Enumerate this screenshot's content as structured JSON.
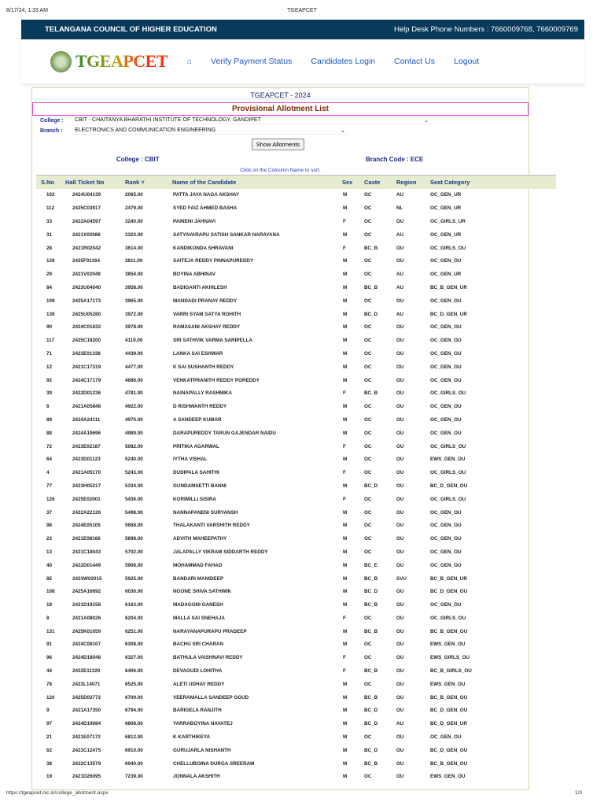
{
  "print": {
    "datetime": "8/17/24, 1:33 AM",
    "title": "TGEAPCET",
    "url": "https://tgeapcet.nic.in/college_allotment.aspx",
    "page": "1/3"
  },
  "topbar": {
    "org": "TELANGANA COUNCIL OF HIGHER EDUCATION",
    "helpdesk": "Help Desk Phone Numbers : 7660009768, 7660009769"
  },
  "nav": {
    "brand": "TGEAPCET",
    "home_icon": "home-icon",
    "home": "⌂",
    "links": [
      "Verify Payment Status",
      "Candidates Login",
      "Contact Us",
      "Logout"
    ]
  },
  "panel": {
    "year": "TGEAPCET - 2024",
    "heading": "Provisional Allotment List",
    "college_label": "College :",
    "college_value": "CBIT - CHAITANYA BHARATHI INSTITUTE OF TECHNOLOGY, GANDIPET",
    "branch_label": "Branch :",
    "branch_value": "ELECTRONICS AND COMMUNICATION ENGINEERING",
    "show_button": "Show Allotments",
    "college_info": "College : CBIT",
    "branch_info": "Branch Code : ECE",
    "hint": "Click on the Coloumn Name to sort."
  },
  "table": {
    "headers": [
      "S.No",
      "Hall Ticket No",
      "Rank ˅",
      "Name of the Candidate",
      "Sex",
      "Caste",
      "Region",
      "Seat Category"
    ],
    "rows": [
      [
        "102",
        "2424U04139",
        "2065.00",
        "PATTA JAYA NAGA AKSHAY",
        "M",
        "OC",
        "AU",
        "OC_GEN_UR"
      ],
      [
        "112",
        "2425C03917",
        "2479.00",
        "SYED FAIZ AHMED BASHA",
        "M",
        "OC",
        "NL",
        "OC_GEN_UR"
      ],
      [
        "33",
        "2422A04597",
        "3240.00",
        "PAINENI JAHNAVI",
        "F",
        "OC",
        "OU",
        "OC_GIRLS_UR"
      ],
      [
        "31",
        "2421X02086",
        "3323.00",
        "SATYAVARAPU SATISH SANKAR NARAYANA",
        "M",
        "OC",
        "AU",
        "OC_GEN_UR"
      ],
      [
        "28",
        "2421R02042",
        "3614.00",
        "KANDIKONDA SHRAVANI",
        "F",
        "BC_B",
        "OU",
        "OC_GIRLS_OU"
      ],
      [
        "128",
        "2425F01164",
        "3811.00",
        "SAITEJA REDDY PINNAPUREDDY",
        "M",
        "OC",
        "OU",
        "OC_GEN_OU"
      ],
      [
        "29",
        "2421V02049",
        "3854.00",
        "BOYINA ABHINAV",
        "M",
        "OC",
        "AU",
        "OC_GEN_UR"
      ],
      [
        "84",
        "2423U04040",
        "3958.00",
        "BADIGANTI AKHILESH",
        "M",
        "BC_B",
        "AU",
        "BC_B_GEN_UR"
      ],
      [
        "109",
        "2425A17173",
        "3965.00",
        "MANDADI PRANAY REDDY",
        "M",
        "OC",
        "OU",
        "OC_GEN_OU"
      ],
      [
        "139",
        "2425U05280",
        "3972.00",
        "VARRI SYAM SATYA ROHITH",
        "M",
        "BC_D",
        "AU",
        "BC_D_GEN_UR"
      ],
      [
        "90",
        "2424C01632",
        "3978.00",
        "RAMASANI AKSHAY REDDY",
        "M",
        "OC",
        "OU",
        "OC_GEN_OU"
      ],
      [
        "117",
        "2425C18200",
        "4119.00",
        "SRI SATHVIK VARMA SARIPELLA",
        "M",
        "OC",
        "OU",
        "OC_GEN_OU"
      ],
      [
        "71",
        "2423E01338",
        "4439.00",
        "LANKA SAI ESHWAR",
        "M",
        "OC",
        "OU",
        "OC_GEN_OU"
      ],
      [
        "12",
        "2421C17319",
        "4477.00",
        "K SAI SUSHANTH REDDY",
        "M",
        "OC",
        "OU",
        "OC_GEN_OU"
      ],
      [
        "92",
        "2424C17179",
        "4686.00",
        "VENKATPRANITH REDDY POREDDY",
        "M",
        "OC",
        "OU",
        "OC_GEN_OU"
      ],
      [
        "39",
        "2422D01236",
        "4781.00",
        "NAINAPALLY RASHMIKA",
        "F",
        "BC_B",
        "OU",
        "OC_GIRLS_OU"
      ],
      [
        "6",
        "2421A05848",
        "4922.00",
        "D RISHWANTH REDDY",
        "M",
        "OC",
        "OU",
        "OC_GEN_OU"
      ],
      [
        "89",
        "2424A24111",
        "4970.00",
        "A SANDEEP KUMAR",
        "M",
        "OC",
        "OU",
        "OC_GEN_OU"
      ],
      [
        "88",
        "2424A19696",
        "4989.00",
        "DARAPUREDDY TARUN GAJENDAR NAIDU",
        "M",
        "OC",
        "OU",
        "OC_GEN_OU"
      ],
      [
        "72",
        "2423E02187",
        "5082.00",
        "PRITIKA AGARWAL",
        "F",
        "OC",
        "OU",
        "OC_GIRLS_OU"
      ],
      [
        "64",
        "2423D01123",
        "5240.00",
        "IYTHA VISHAL",
        "M",
        "OC",
        "OU",
        "EWS_GEN_OU"
      ],
      [
        "4",
        "2421A05170",
        "5243.00",
        "DUDIPALA SAHITHI",
        "F",
        "OC",
        "OU",
        "OC_GIRLS_OU"
      ],
      [
        "77",
        "2423H05217",
        "5334.00",
        "GUNDAMSETTI BANNI",
        "M",
        "BC_D",
        "OU",
        "BC_D_GEN_OU"
      ],
      [
        "126",
        "2425E02001",
        "5436.00",
        "KORIMILLI SISIRA",
        "F",
        "OC",
        "OU",
        "OC_GIRLS_OU"
      ],
      [
        "37",
        "2422A22126",
        "5498.00",
        "NANNAPANENI SURYANSH",
        "M",
        "OC",
        "OU",
        "OC_GEN_OU"
      ],
      [
        "98",
        "2424E05105",
        "5668.00",
        "THALAKANTI VARSHITH REDDY",
        "M",
        "OC",
        "OU",
        "OC_GEN_OU"
      ],
      [
        "23",
        "2421E08166",
        "5698.00",
        "ADVITH MAHEEPATHY",
        "M",
        "OC",
        "OU",
        "OC_GEN_OU"
      ],
      [
        "13",
        "2421C18043",
        "5702.00",
        "JALAPALLY VIKRAM SIDDARTH REDDY",
        "M",
        "OC",
        "OU",
        "OC_GEN_OU"
      ],
      [
        "40",
        "2422D01449",
        "5906.00",
        "MOHAMMAD FAHAD",
        "M",
        "BC_E",
        "OU",
        "OC_GEN_OU"
      ],
      [
        "85",
        "2423W02015",
        "5925.00",
        "BANDARI MANIDEEP",
        "M",
        "BC_B",
        "SVU",
        "BC_B_GEN_UR"
      ],
      [
        "108",
        "2425A16692",
        "6030.00",
        "NOONE SHIVA SATHWIK",
        "M",
        "BC_D",
        "OU",
        "BC_D_GEN_OU"
      ],
      [
        "18",
        "2421D19158",
        "6163.00",
        "MADAGONI GANESH",
        "M",
        "BC_B",
        "OU",
        "OC_GEN_OU"
      ],
      [
        "8",
        "2421A08026",
        "6204.00",
        "MALLA SAI SNEHAJA",
        "F",
        "OC",
        "OU",
        "OC_GIRLS_OU"
      ],
      [
        "131",
        "2425K01059",
        "6251.00",
        "NARAYANAPURAPU PRADEEP",
        "M",
        "BC_B",
        "OU",
        "BC_B_GEN_OU"
      ],
      [
        "91",
        "2424C08107",
        "6308.00",
        "BACHU SRI CHARAN",
        "M",
        "OC",
        "OU",
        "EWS_GEN_OU"
      ],
      [
        "96",
        "2424D18048",
        "6327.00",
        "BATHULA VAISHNAVI REDDY",
        "F",
        "OC",
        "OU",
        "EWS_GIRLS_OU"
      ],
      [
        "44",
        "2422E11320",
        "6406.00",
        "DEVAGUDI LOHITHA",
        "F",
        "BC_B",
        "OU",
        "BC_B_GIRLS_OU"
      ],
      [
        "78",
        "2423L14071",
        "6525.00",
        "ALETI UDHAY REDDY",
        "M",
        "OC",
        "OU",
        "EWS_GEN_OU"
      ],
      [
        "120",
        "2425D03772",
        "6709.00",
        "VEERAMALLA SANDEEP GOUD",
        "M",
        "BC_B",
        "OU",
        "BC_B_GEN_OU"
      ],
      [
        "9",
        "2421A17350",
        "6794.00",
        "BARIGELA RANJITH",
        "M",
        "BC_D",
        "OU",
        "BC_D_GEN_OU"
      ],
      [
        "97",
        "2424D19084",
        "6808.00",
        "YARRABOYINA NAVATEJ",
        "M",
        "BC_D",
        "AU",
        "BC_D_GEN_UR"
      ],
      [
        "21",
        "2421E07172",
        "6812.00",
        "K KARTHIKEYA",
        "M",
        "OC",
        "OU",
        "OC_GEN_OU"
      ],
      [
        "62",
        "2423C12475",
        "6910.00",
        "GURUJARLA NISHANTH",
        "M",
        "BC_D",
        "OU",
        "BC_D_GEN_OU"
      ],
      [
        "38",
        "2422C13579",
        "6940.00",
        "CHELLUBOINA DURGA SREERAM",
        "M",
        "BC_B",
        "OU",
        "BC_B_GEN_OU"
      ],
      [
        "19",
        "2421D26095",
        "7239.00",
        "JONNALA AKSHITH",
        "M",
        "OC",
        "OU",
        "EWS_GEN_OU"
      ]
    ]
  }
}
